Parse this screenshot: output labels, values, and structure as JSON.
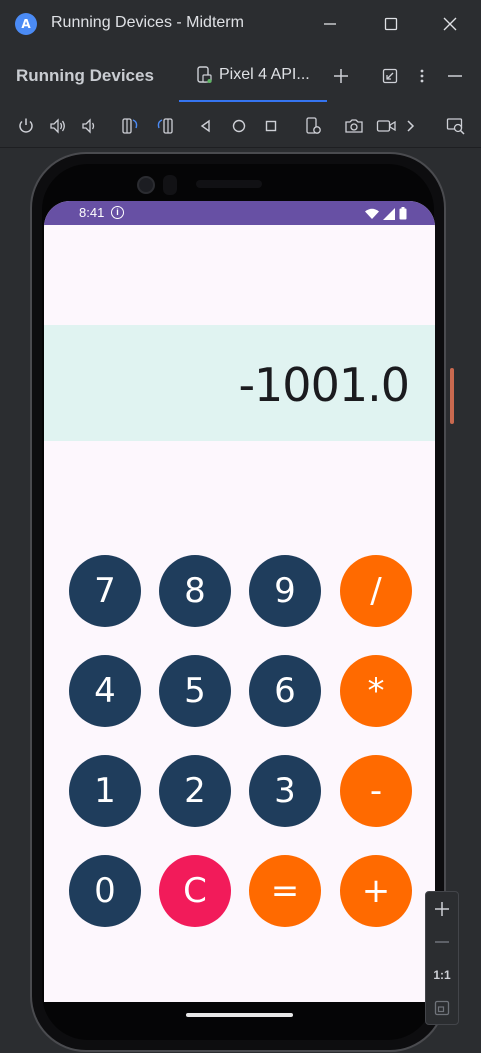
{
  "window": {
    "title": "Running Devices - Midterm",
    "logo_letter": "A"
  },
  "toolwindow": {
    "label": "Running Devices",
    "tab_label": "Pixel 4 API..."
  },
  "device": {
    "status_time": "8:41",
    "status_info": "i",
    "display_value": "-1001.0"
  },
  "keypad": {
    "rows": [
      [
        {
          "label": "7",
          "kind": "num"
        },
        {
          "label": "8",
          "kind": "num"
        },
        {
          "label": "9",
          "kind": "num"
        },
        {
          "label": "/",
          "kind": "op"
        }
      ],
      [
        {
          "label": "4",
          "kind": "num"
        },
        {
          "label": "5",
          "kind": "num"
        },
        {
          "label": "6",
          "kind": "num"
        },
        {
          "label": "*",
          "kind": "op"
        }
      ],
      [
        {
          "label": "1",
          "kind": "num"
        },
        {
          "label": "2",
          "kind": "num"
        },
        {
          "label": "3",
          "kind": "num"
        },
        {
          "label": "-",
          "kind": "op"
        }
      ],
      [
        {
          "label": "0",
          "kind": "num"
        },
        {
          "label": "C",
          "kind": "clear"
        },
        {
          "label": "=",
          "kind": "op"
        },
        {
          "label": "+",
          "kind": "op"
        }
      ]
    ]
  },
  "zoom": {
    "actual_size_label": "1:1"
  },
  "colors": {
    "status_bar": "#6750a4",
    "display_bg": "#e0f3f1",
    "key_number": "#1f3d5c",
    "key_operator": "#ff6a00",
    "key_clear": "#f21b5a",
    "screen_bg": "#fdf7fd"
  }
}
